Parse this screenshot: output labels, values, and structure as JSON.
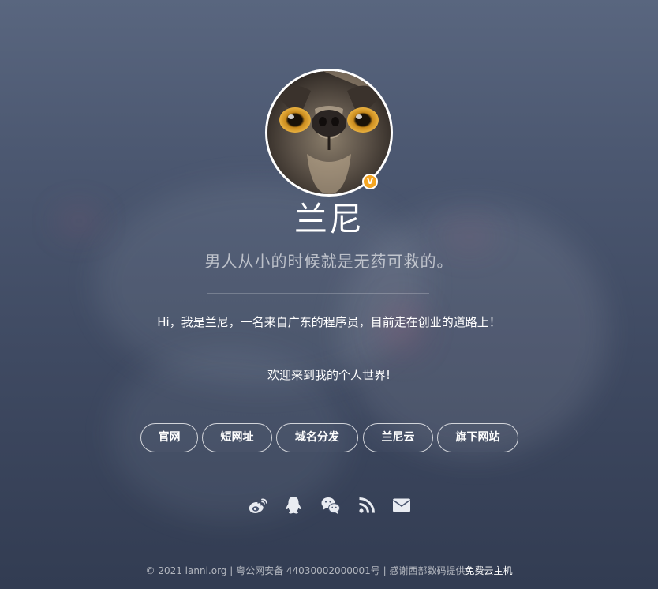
{
  "profile": {
    "name": "兰尼",
    "motto": "男人从小的时候就是无药可救的。",
    "verified_badge": "V",
    "intro": "Hi，我是兰尼，一名来自广东的程序员，目前走在创业的道路上！",
    "welcome": "欢迎来到我的个人世界!"
  },
  "nav": [
    {
      "label": "官网"
    },
    {
      "label": "短网址"
    },
    {
      "label": "域名分发"
    },
    {
      "label": "兰尼云"
    },
    {
      "label": "旗下网站"
    }
  ],
  "social": [
    {
      "icon": "weibo-icon"
    },
    {
      "icon": "qq-icon"
    },
    {
      "icon": "wechat-icon"
    },
    {
      "icon": "rss-icon"
    },
    {
      "icon": "mail-icon"
    }
  ],
  "footer": {
    "text": "© 2021 lanni.org | 粤公网安备 44030002000001号 | 感谢西部数码提供",
    "link_label": "免费云主机"
  },
  "colors": {
    "badge": "#f5a623",
    "background_top": "#59667f",
    "background_bottom": "#323c52"
  }
}
